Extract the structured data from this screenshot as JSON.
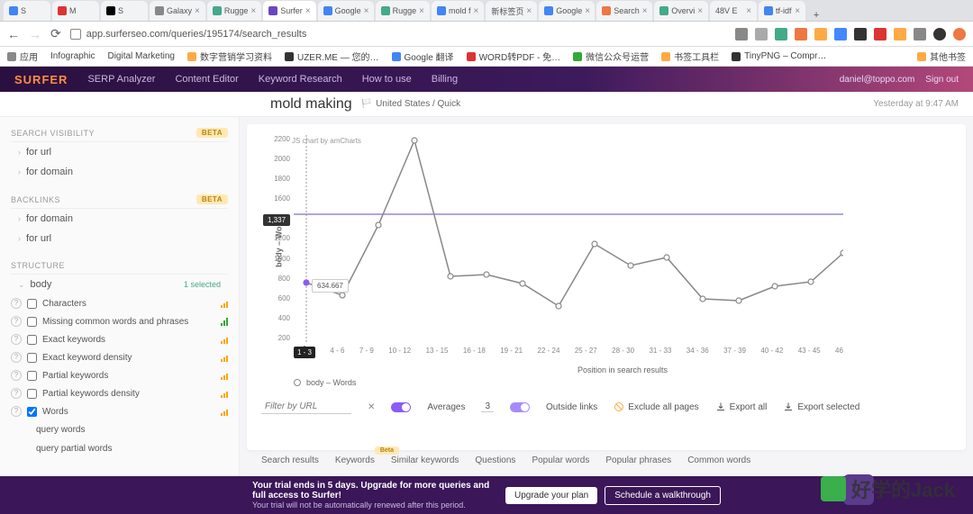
{
  "browser": {
    "tabs": [
      "S",
      "M",
      "S",
      "Galaxy",
      "Rugge",
      "Surfer",
      "Google",
      "Rugge",
      "mold f",
      "新标签页",
      "Google",
      "Search",
      "Overvi",
      "48V E",
      "tf-idf"
    ],
    "active_tab_index": 5,
    "url": "app.surferseo.com/queries/195174/search_results",
    "bookmarks": [
      "应用",
      "Infographic",
      "Digital Marketing",
      "数字营销学习资料",
      "UZER.ME — 您的…",
      "Google 翻译",
      "WORD转PDF - 免…",
      "微信公众号运营",
      "书签工具栏",
      "TinyPNG – Compr…",
      "其他书签"
    ]
  },
  "header": {
    "logo": "SURFER",
    "nav": [
      "SERP Analyzer",
      "Content Editor",
      "Keyword Research",
      "How to use",
      "Billing"
    ],
    "user": "daniel@toppo.com",
    "signout": "Sign out"
  },
  "page": {
    "title": "mold making",
    "location": "United States / Quick",
    "timestamp": "Yesterday at 9:47 AM"
  },
  "sidebar": {
    "search_visibility": {
      "label": "SEARCH VISIBILITY",
      "beta": "Beta",
      "items": [
        "for url",
        "for domain"
      ]
    },
    "backlinks": {
      "label": "BACKLINKS",
      "beta": "Beta",
      "items": [
        "for domain",
        "for url"
      ]
    },
    "structure": {
      "label": "STRUCTURE",
      "body": "body",
      "selected": "1 selected",
      "metrics": [
        "Characters",
        "Missing common words and phrases",
        "Exact keywords",
        "Exact keyword density",
        "Partial keywords",
        "Partial keywords density",
        "Words"
      ],
      "sub": [
        "query words",
        "query partial words"
      ]
    }
  },
  "chart_data": {
    "type": "line",
    "title": "",
    "attribution": "JS chart by amCharts",
    "xlabel": "Position in search results",
    "ylabel": "body – Words",
    "ylim": [
      0,
      2200
    ],
    "y_ticks": [
      2200,
      2000,
      1800,
      1600,
      1400,
      1200,
      1000,
      800,
      600,
      400,
      200
    ],
    "categories": [
      "1 - 3",
      "4 - 6",
      "7 - 9",
      "10 - 12",
      "13 - 15",
      "16 - 18",
      "19 - 21",
      "22 - 24",
      "25 - 27",
      "28 - 30",
      "31 - 33",
      "34 - 36",
      "37 - 39",
      "40 - 42",
      "43 - 45",
      "46"
    ],
    "series": [
      {
        "name": "body – Words",
        "values": [
          634.667,
          500,
          1250,
          2150,
          700,
          720,
          620,
          380,
          1050,
          820,
          900,
          460,
          440,
          600,
          650,
          960
        ]
      }
    ],
    "reference_line": 1364,
    "hover": {
      "x_index": 0,
      "value_label": "634.667",
      "axis_label": "1,337"
    },
    "legend": [
      "body – Words"
    ]
  },
  "filters": {
    "placeholder": "Filter by URL",
    "averages": "Averages",
    "averages_value": "3",
    "outside": "Outside links",
    "exclude": "Exclude all pages",
    "export_all": "Export all",
    "export_sel": "Export selected"
  },
  "result_tabs": [
    "Search results",
    "Keywords",
    "Similar keywords",
    "Questions",
    "Popular words",
    "Popular phrases",
    "Common words"
  ],
  "trial": {
    "line1": "Your trial ends in 5 days. Upgrade for more queries and full access to Surfer!",
    "line2": "Your trial will not be automatically renewed after this period.",
    "btn1": "Upgrade your plan",
    "btn2": "Schedule a walkthrough"
  },
  "watermark": "好学的Jack"
}
